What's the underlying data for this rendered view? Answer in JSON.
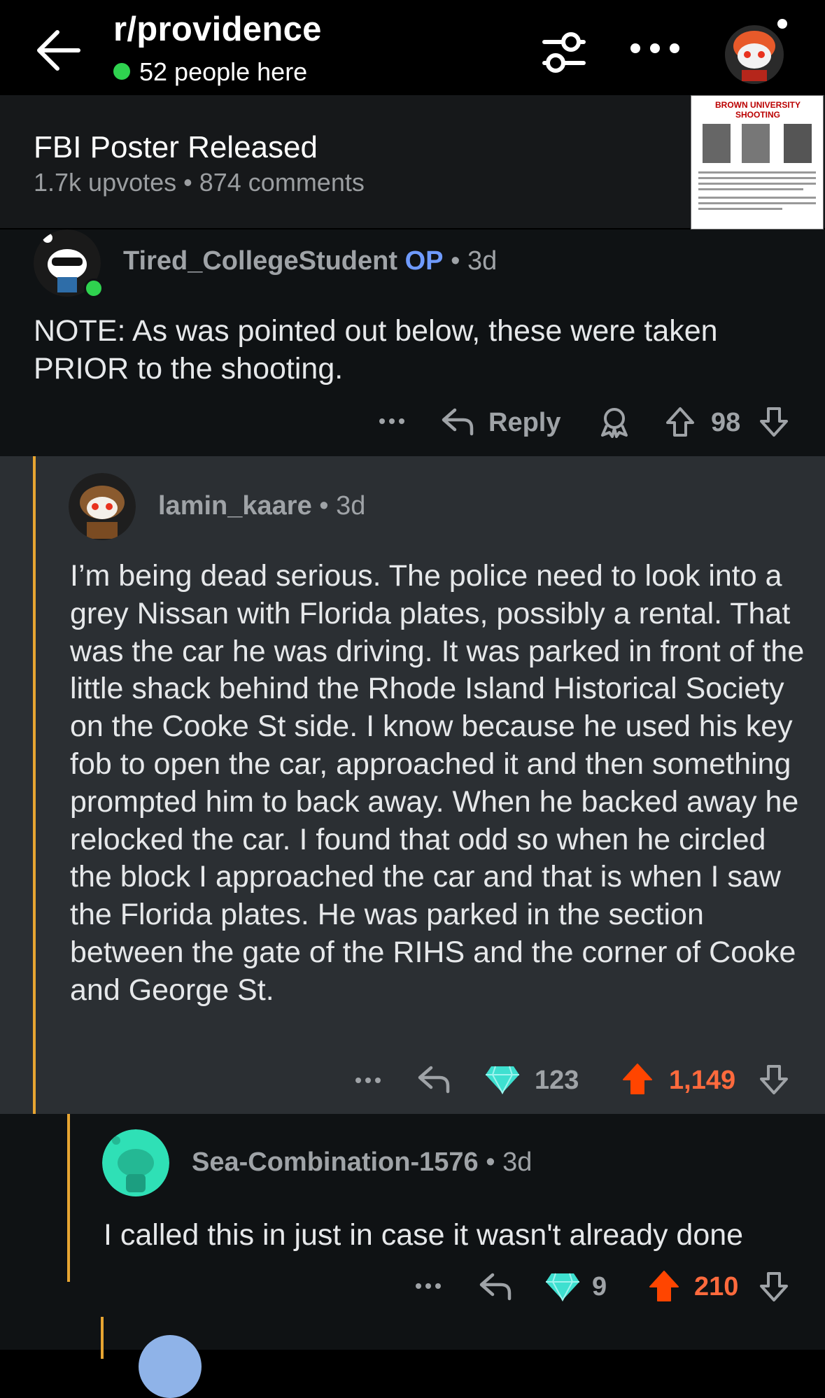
{
  "header": {
    "subreddit": "r/providence",
    "online_text": "52 people here"
  },
  "post": {
    "title": "FBI Poster Released",
    "meta": "1.7k upvotes • 874 comments",
    "thumbnail_heading": "BROWN UNIVERSITY SHOOTING"
  },
  "comments": [
    {
      "username": "Tired_CollegeStudent",
      "op_badge": "OP",
      "age": "3d",
      "body": "NOTE: As was pointed out below, these were taken PRIOR to the shooting.",
      "reply_label": "Reply",
      "score": "98"
    },
    {
      "username": "lamin_kaare",
      "age": "3d",
      "body": "I’m being dead serious. The police need to look into a grey Nissan with Florida plates, possibly a rental. That was the car he was driving. It was parked in front of the little shack behind the Rhode Island Historical Society on the Cooke St side. I know because he used his key fob to open the car, approached it and then something prompted him to back away. When he backed away he relocked the car. I found that odd so when he circled the block I approached the car and that is when I saw the Florida plates. He was parked in the section between the gate of the RIHS and the corner of Cooke and George St.",
      "gems": "123",
      "score": "1,149"
    },
    {
      "username": "Sea-Combination-1576",
      "age": "3d",
      "body": "I called this in just in case it wasn't already done",
      "gems": "9",
      "score": "210"
    }
  ],
  "colors": {
    "accent_upvote": "#ff4500",
    "score_upvoted": "#ff6a3d",
    "online": "#2fd24f",
    "op": "#6f9bff",
    "thread_line": "#e7a532"
  },
  "icons": [
    "back-arrow-icon",
    "filter-icon",
    "more-icon",
    "reply-icon",
    "award-icon",
    "upvote-icon",
    "downvote-icon",
    "gem-icon"
  ]
}
